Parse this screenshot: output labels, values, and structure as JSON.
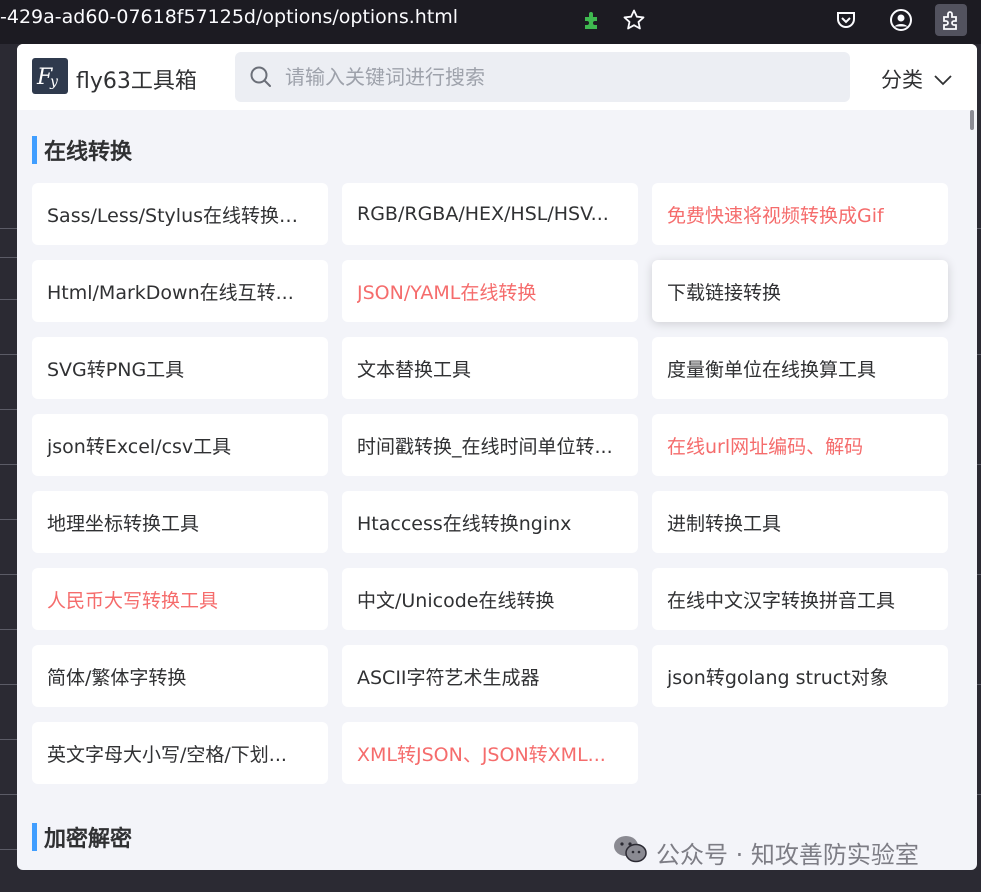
{
  "browser": {
    "url": "-429a-ad60-07618f57125d/options/options.html",
    "icons": [
      "puzzle-icon",
      "star-icon",
      "pocket-icon",
      "account-icon",
      "extensions-icon"
    ]
  },
  "header": {
    "logo_text": "fly63工具箱",
    "search_placeholder": "请输入关键词进行搜索",
    "category_label": "分类"
  },
  "sections": [
    {
      "title": "在线转换",
      "items": [
        {
          "label": "Sass/Less/Stylus在线转换工...",
          "hot": false
        },
        {
          "label": "RGB/RGBA/HEX/HSL/HSV...",
          "hot": false
        },
        {
          "label": "免费快速将视频转换成Gif",
          "hot": true
        },
        {
          "label": "Html/MarkDown在线互转...",
          "hot": false
        },
        {
          "label": "JSON/YAML在线转换",
          "hot": true
        },
        {
          "label": "下载链接转换",
          "hot": false
        },
        {
          "label": "SVG转PNG工具",
          "hot": false
        },
        {
          "label": "文本替换工具",
          "hot": false
        },
        {
          "label": "度量衡单位在线换算工具",
          "hot": false
        },
        {
          "label": "json转Excel/csv工具",
          "hot": false
        },
        {
          "label": "时间戳转换_在线时间单位转...",
          "hot": false
        },
        {
          "label": "在线url网址编码、解码",
          "hot": true
        },
        {
          "label": "地理坐标转换工具",
          "hot": false
        },
        {
          "label": "Htaccess在线转换nginx",
          "hot": false
        },
        {
          "label": "进制转换工具",
          "hot": false
        },
        {
          "label": "人民币大写转换工具",
          "hot": true
        },
        {
          "label": "中文/Unicode在线转换",
          "hot": false
        },
        {
          "label": "在线中文汉字转换拼音工具",
          "hot": false
        },
        {
          "label": "简体/繁体字转换",
          "hot": false
        },
        {
          "label": "ASCII字符艺术生成器",
          "hot": false
        },
        {
          "label": "json转golang struct对象",
          "hot": false
        },
        {
          "label": "英文字母大小写/空格/下划...",
          "hot": false
        },
        {
          "label": "XML转JSON、JSON转XML...",
          "hot": true
        }
      ]
    },
    {
      "title": "加密解密",
      "items": []
    }
  ],
  "watermark": "公众号 · 知攻善防实验室",
  "colors": {
    "accent": "#409eff",
    "hot": "#f56c6c",
    "text": "#303133",
    "popup_bg": "#f3f4f9"
  }
}
